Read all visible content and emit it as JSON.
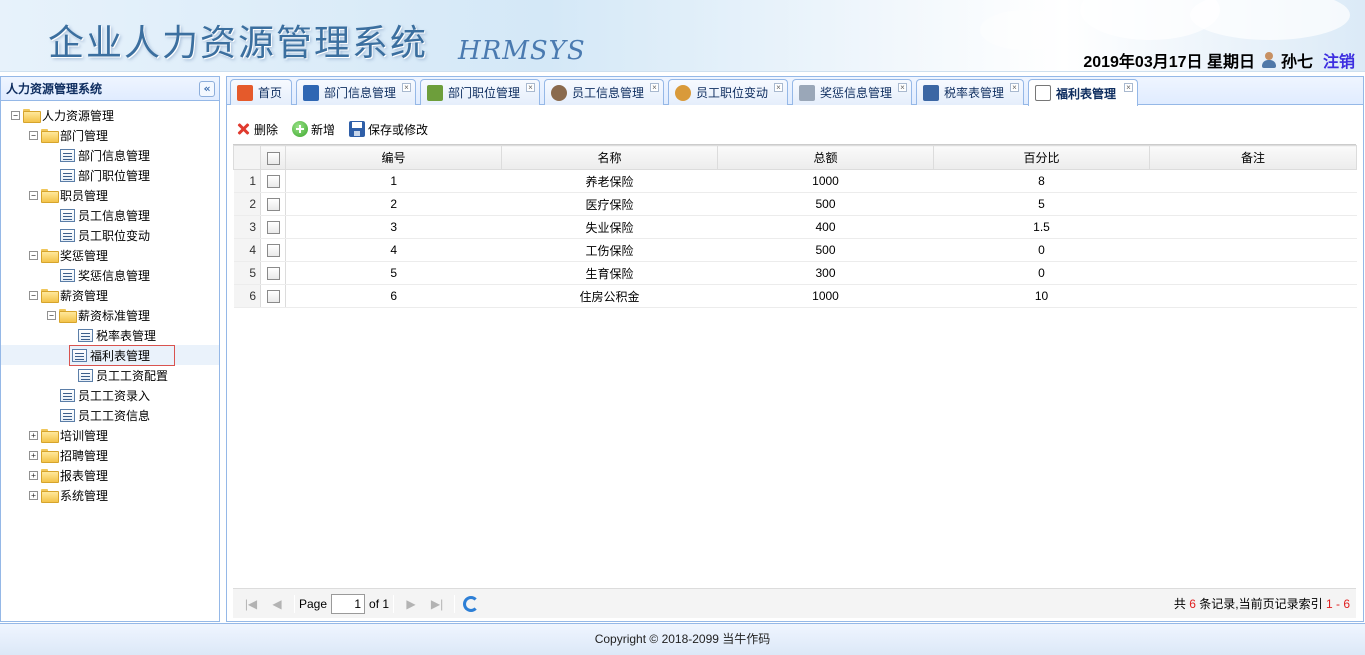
{
  "header": {
    "title": "企业人力资源管理系统",
    "subtitle": "HRMSYS",
    "date": "2019年03月17日 星期日",
    "username": "孙七",
    "logout_label": "注销"
  },
  "sidebar": {
    "title": "人力资源管理系统",
    "collapse_glyph": "«",
    "tree": {
      "root": "人力资源管理",
      "dept": "部门管理",
      "dept_info": "部门信息管理",
      "dept_pos": "部门职位管理",
      "staff": "职员管理",
      "staff_info": "员工信息管理",
      "staff_pos": "员工职位变动",
      "reward": "奖惩管理",
      "reward_info": "奖惩信息管理",
      "salary": "薪资管理",
      "salary_std": "薪资标准管理",
      "tax": "税率表管理",
      "welfare": "福利表管理",
      "wage_conf": "员工工资配置",
      "wage_entry": "员工工资录入",
      "wage_info": "员工工资信息",
      "train": "培训管理",
      "recruit": "招聘管理",
      "report": "报表管理",
      "system": "系统管理"
    }
  },
  "tabs": [
    "首页",
    "部门信息管理",
    "部门职位管理",
    "员工信息管理",
    "员工职位变动",
    "奖惩信息管理",
    "税率表管理",
    "福利表管理"
  ],
  "toolbar": {
    "delete_label": "删除",
    "add_label": "新增",
    "save_label": "保存或修改"
  },
  "grid": {
    "columns": [
      "编号",
      "名称",
      "总额",
      "百分比",
      "备注"
    ],
    "rows": [
      {
        "n": "1",
        "id": "1",
        "name": "养老保险",
        "total": "1000",
        "pct": "8",
        "note": ""
      },
      {
        "n": "2",
        "id": "2",
        "name": "医疗保险",
        "total": "500",
        "pct": "5",
        "note": ""
      },
      {
        "n": "3",
        "id": "3",
        "name": "失业保险",
        "total": "400",
        "pct": "1.5",
        "note": ""
      },
      {
        "n": "4",
        "id": "4",
        "name": "工伤保险",
        "total": "500",
        "pct": "0",
        "note": ""
      },
      {
        "n": "5",
        "id": "5",
        "name": "生育保险",
        "total": "300",
        "pct": "0",
        "note": ""
      },
      {
        "n": "6",
        "id": "6",
        "name": "住房公积金",
        "total": "1000",
        "pct": "10",
        "note": ""
      }
    ]
  },
  "pager": {
    "page_label": "Page",
    "page_value": "1",
    "of_label": "of 1",
    "info_prefix": "共",
    "total": "6",
    "info_mid": "条记录,当前页记录索引",
    "range": "1 - 6"
  },
  "footer": {
    "text": "Copyright © 2018-2099 当牛作码"
  }
}
